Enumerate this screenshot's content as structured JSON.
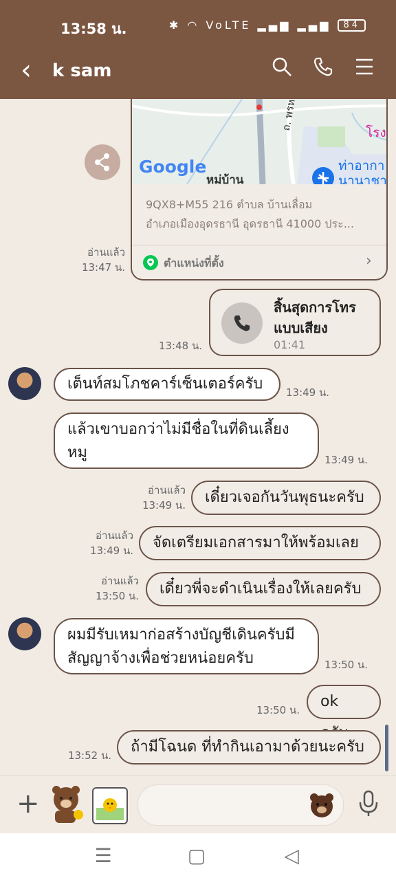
{
  "status": {
    "time": "13:58 น.",
    "battery": "84",
    "indicators": "✱ ◠ VoLTE ▂▄▆ ▂▄▆"
  },
  "header": {
    "title": "k sam",
    "back_icon": "‹",
    "search_icon": "search-icon",
    "call_icon": "phone-icon",
    "menu_icon": "menu-icon"
  },
  "location": {
    "map_label_google": "Google",
    "map_label_village": "หมู่บ้าน",
    "map_label_road": "ถ. พรหมมุง",
    "map_label_airport": "ท่าอากา นานาชา",
    "map_label_school": "โรง",
    "address_line1": "9QX8+M55 216 ตำบล บ้านเลื่อม",
    "address_line2": "อำเภอเมืองอุดรธานี อุดรธานี 41000 ประ...",
    "link_label": "ตำแหน่งที่ตั้ง",
    "read": "อ่านแล้ว",
    "time": "13:47 น."
  },
  "call": {
    "title_line1": "สิ้นสุดการโทร",
    "title_line2": "แบบเสียง",
    "duration": "01:41",
    "time": "13:48 น."
  },
  "messages": [
    {
      "text": "เต็นท์สมโภชคาร์เซ็นเตอร์ครับ",
      "time": "13:49 น."
    },
    {
      "line1": "แล้วเขาบอกว่าไม่มีชื่อในที่ดินเลี้ยง",
      "line2": "หมู",
      "time": "13:49 น."
    },
    {
      "text": "เดี๋ยวเจอกันวันพุธนะครับ",
      "read": "อ่านแล้ว",
      "time": "13:49 น."
    },
    {
      "text": "จัดเตรียมเอกสารมาให้พร้อมเลย",
      "read": "อ่านแล้ว",
      "time": "13:49 น."
    },
    {
      "text": "เดี๋ยวพี่จะดำเนินเรื่องให้เลยครับ",
      "read": "อ่านแล้ว",
      "time": "13:50 น."
    },
    {
      "line1": "ผมมีรับเหมาก่อสร้างบัญชีเดินครับมี",
      "line2": "สัญญาจ้างเพื่อช่วยหน่อยครับ",
      "time": "13:50 น."
    },
    {
      "text": "ok ครับ",
      "time": "13:50 น."
    },
    {
      "text": "ถ้ามีโฉนด ที่ทำกินเอามาด้วยนะครับ",
      "time": "13:52 น."
    }
  ],
  "input": {
    "plus": "+",
    "placeholder": ""
  },
  "colors": {
    "header": "#7b5641",
    "chat_bg": "#f1ebe4",
    "bubble_border": "#6b5448"
  }
}
